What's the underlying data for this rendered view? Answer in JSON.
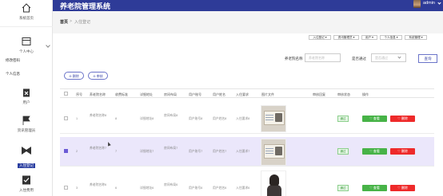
{
  "app": {
    "title": "养老院管理系统",
    "user_name": "admin"
  },
  "breadcrumb": {
    "home": "首页",
    "separator": ">",
    "current": "入住登记"
  },
  "sidebar": {
    "items": [
      {
        "label": "系统首页",
        "icon": "home-icon"
      },
      {
        "label": "个人中心",
        "icon": "window-icon"
      },
      {
        "label": "用户",
        "icon": "clipboard-x-icon"
      },
      {
        "label": "资讯管理员",
        "icon": "flag-icon"
      },
      {
        "label": "入住登记",
        "icon": "bowtie-icon"
      },
      {
        "label": "入住费用",
        "icon": "checklist-icon"
      }
    ],
    "sub_items": [
      "修改密码",
      "个人信息"
    ]
  },
  "toolbar": [
    "入住登记 ▾",
    "资讯管理员 ▾",
    "用户 ▾",
    "个人信息 ▾",
    "系统管理 ▾"
  ],
  "search": {
    "name_label": "养老院名称",
    "name_placeholder": "养老院名称",
    "review_label": "是否通过",
    "review_placeholder": "是否通过",
    "button": "查询"
  },
  "actions": {
    "delete": "⊖ 删除",
    "review": "⊖ 审核"
  },
  "table": {
    "columns": [
      "序号",
      "养老院名称",
      "收费标准",
      "详细地址",
      "房间布局",
      "用户账号",
      "用户姓名",
      "入住要求",
      "图片文件",
      "审核回复",
      "审核状态",
      "操作"
    ],
    "rows": [
      {
        "index": "1",
        "name": "养老院名称8",
        "fee": "8",
        "address": "详细地址8",
        "layout": "房间布局8",
        "account": "用户账号8",
        "username": "用户姓名8",
        "requirement": "入住要求8",
        "reply": "",
        "status": "通过",
        "thumb": "id-card",
        "selected": false,
        "checked": false
      },
      {
        "index": "2",
        "name": "养老院名称7",
        "fee": "7",
        "address": "详细地址7",
        "layout": "房间布局7",
        "account": "用户账号7",
        "username": "用户姓名7",
        "requirement": "入住要求7",
        "reply": "",
        "status": "通过",
        "thumb": "id-card",
        "selected": true,
        "checked": true
      },
      {
        "index": "3",
        "name": "养老院名称6",
        "fee": "6",
        "address": "详细地址6",
        "layout": "房间布局6",
        "account": "用户账号6",
        "username": "用户姓名6",
        "requirement": "入住要求6",
        "reply": "",
        "status": "通过",
        "thumb": "portrait",
        "selected": false,
        "checked": false
      }
    ],
    "view_label": "♡ 查看",
    "delete_label": "♡ 删除"
  },
  "colors": {
    "header": "#2e3b98",
    "selected_row": "#ebe7fb",
    "view": "#47b347",
    "delete": "#ee2a2a"
  }
}
